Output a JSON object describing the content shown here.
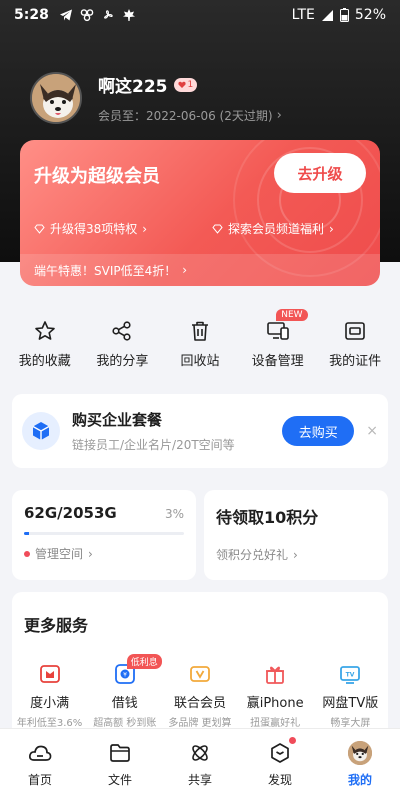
{
  "status_bar": {
    "time": "5:28",
    "network": "LTE",
    "battery": "52%"
  },
  "profile": {
    "username": "啊这225",
    "vip_level": "1",
    "member_until": "会员至：2022-06-06 (2天过期)"
  },
  "vip_card": {
    "title": "升级为超级会员",
    "upgrade_button": "去升级",
    "link1": "升级得38项特权",
    "link2": "探索会员频道福利",
    "promo": "端午特惠！SVIP低至4折！"
  },
  "quick_actions": [
    {
      "label": "我的收藏",
      "icon": "star-icon"
    },
    {
      "label": "我的分享",
      "icon": "share-icon"
    },
    {
      "label": "回收站",
      "icon": "trash-icon"
    },
    {
      "label": "设备管理",
      "icon": "devices-icon",
      "tag": "NEW"
    },
    {
      "label": "我的证件",
      "icon": "id-card-icon"
    }
  ],
  "enterprise": {
    "title": "购买企业套餐",
    "subtitle": "链接员工/企业名片/20T空间等",
    "button": "去购买",
    "close": "×"
  },
  "storage": {
    "value": "62G/2053G",
    "percent": "3%",
    "fill_fraction": 0.03,
    "link": "管理空间"
  },
  "points": {
    "title": "待领取10积分",
    "link": "领积分兑好礼"
  },
  "services": {
    "title": "更多服务",
    "items": [
      {
        "label": "度小满",
        "sub": "年利低至3.6%",
        "icon": "duxiaoman-icon",
        "color": "#e8423c"
      },
      {
        "label": "借钱",
        "sub": "超高额 秒到账",
        "icon": "loan-icon",
        "color": "#1f6ef5",
        "tag": "低利息"
      },
      {
        "label": "联合会员",
        "sub": "多品牌 更划算",
        "icon": "vip-union-icon",
        "color": "#f2a93b"
      },
      {
        "label": "赢iPhone",
        "sub": "扭蛋赢好礼",
        "icon": "gift-icon",
        "color": "#f0585a"
      },
      {
        "label": "网盘TV版",
        "sub": "畅享大屏",
        "icon": "tv-icon",
        "color": "#3aa6e8"
      }
    ]
  },
  "tabbar": [
    {
      "label": "首页",
      "icon": "cloud-home-icon",
      "active": false
    },
    {
      "label": "文件",
      "icon": "folder-icon",
      "active": false
    },
    {
      "label": "共享",
      "icon": "share-atom-icon",
      "active": false
    },
    {
      "label": "发现",
      "icon": "discover-icon",
      "active": false,
      "dot": true
    },
    {
      "label": "我的",
      "icon": "avatar-icon",
      "active": true
    }
  ],
  "colors": {
    "accent": "#1f6ef5",
    "vip_red": "#ef4c4c",
    "dot_red": "#f04c5a"
  }
}
